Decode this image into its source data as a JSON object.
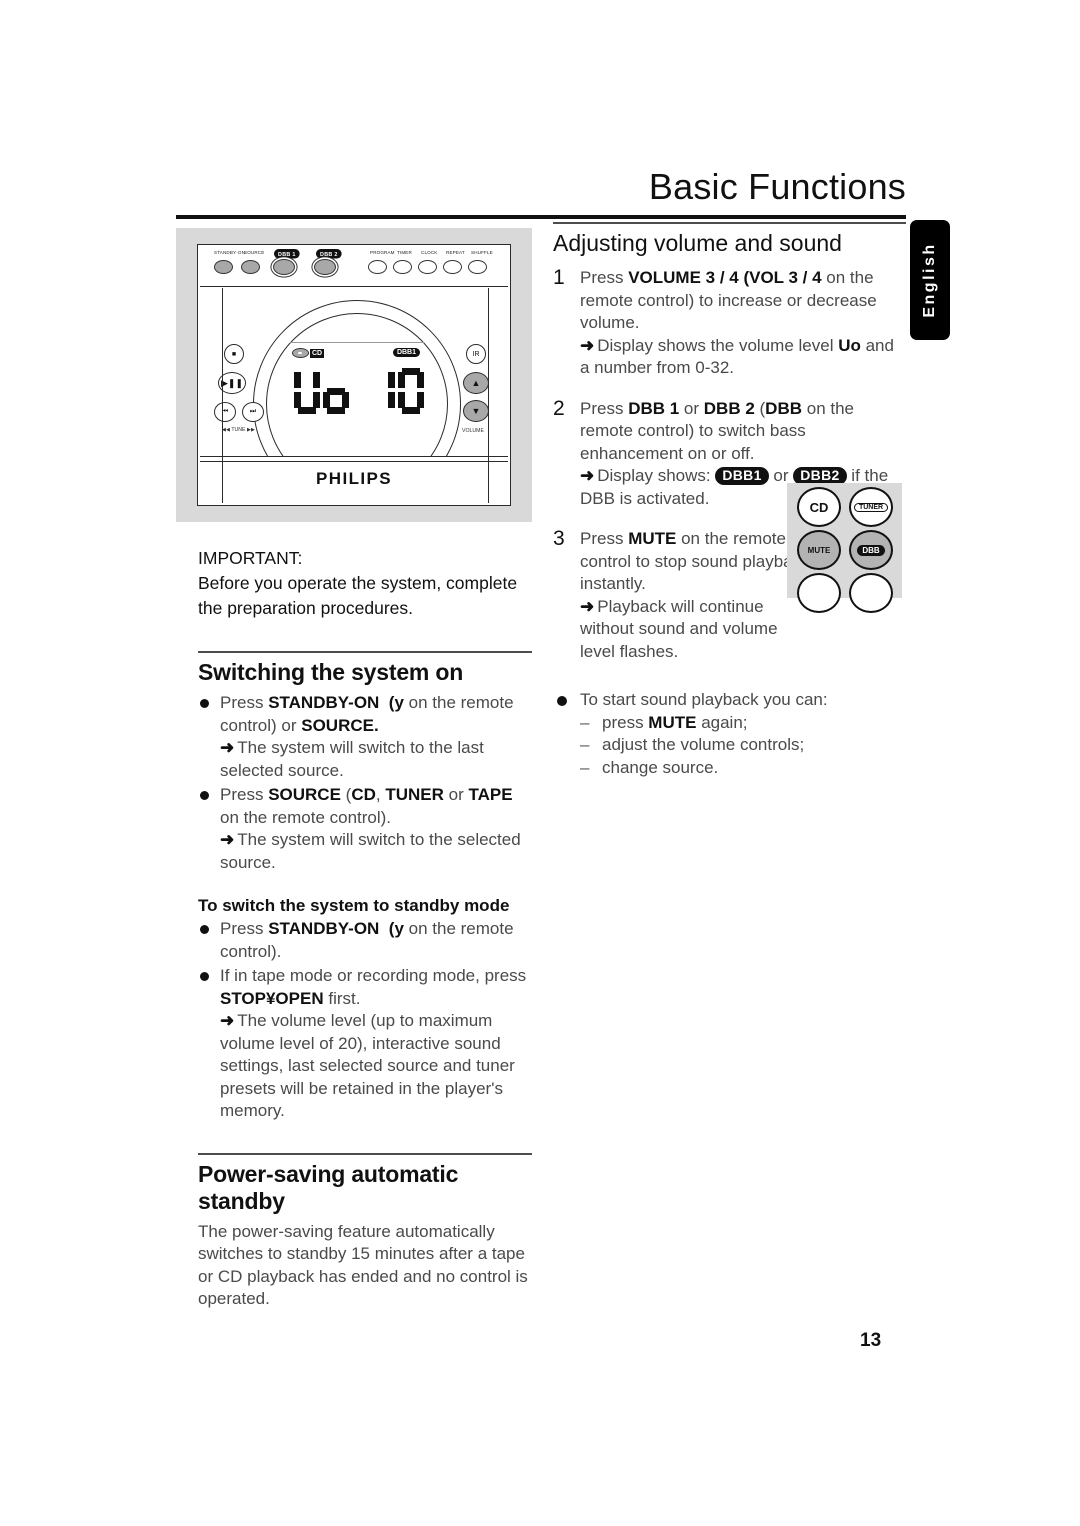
{
  "page": {
    "title": "Basic Functions",
    "number": "13",
    "language_tab": "English"
  },
  "illustration": {
    "brand": "PHILIPS",
    "top_buttons": [
      "STANDBY·ON",
      "SOURCE",
      "DBB 1",
      "DBB 2",
      "PROGRAM",
      "TIMER",
      "CLOCK",
      "REPEAT",
      "SHUFFLE"
    ],
    "display": {
      "source_indicator": "CD",
      "dbb_indicator": "DBB1",
      "readout": "Uo 10"
    },
    "side_labels": {
      "tune": "TUNE",
      "volume": "VOLUME"
    }
  },
  "left_column": {
    "important": {
      "heading": "IMPORTANT:",
      "text": "Before you operate the system, complete the preparation procedures."
    },
    "switching_on": {
      "heading": "Switching the system on",
      "bullet1_lead": "Press ",
      "bullet1_kw": "STANDBY-ON",
      "bullet1_paren_open": "(",
      "bullet1_symbol": "y",
      "bullet1_mid": " on the remote control) or ",
      "bullet1_kw2": "SOURCE.",
      "bullet1_arrow": "The system will switch to the last selected source.",
      "bullet2_lead": "Press ",
      "bullet2_kw": "SOURCE",
      "bullet2_mid1": " (",
      "bullet2_kw2": "CD",
      "bullet2_mid2": ", ",
      "bullet2_kw3": "TUNER",
      "bullet2_mid3": " or ",
      "bullet2_kw4": "TAPE",
      "bullet2_mid4": " on the remote control).",
      "bullet2_arrow": "The system will switch to the selected source."
    },
    "standby_mode": {
      "heading": "To switch the system to standby mode",
      "bullet1_lead": "Press ",
      "bullet1_kw": "STANDBY-ON",
      "bullet1_paren_open": "(",
      "bullet1_symbol": "y",
      "bullet1_mid": " on the remote control).",
      "bullet2_lead": "If in tape mode or recording mode, press ",
      "bullet2_kw": "STOP¥OPEN",
      "bullet2_tail": " first.",
      "bullet2_arrow": "The volume level (up to maximum volume level of 20), interactive sound settings, last selected source and tuner presets will be retained in the player's memory."
    },
    "power_saving": {
      "heading": "Power-saving automatic standby",
      "text": "The power-saving feature automatically switches to standby 15 minutes after a tape or CD playback has ended and no control is operated."
    }
  },
  "right_column": {
    "heading": "Adjusting volume and sound",
    "steps": [
      {
        "num": "1",
        "lead": "Press ",
        "kw": "VOLUME",
        "mid1": " 3 / 4 (",
        "kw2": "VOL",
        "mid2": " 3 / 4",
        "tail": " on the remote control) to increase or decrease volume.",
        "arrow_lead": "Display shows the volume level ",
        "arrow_kw": "Uo",
        "arrow_tail": " and a number from 0-32."
      },
      {
        "num": "2",
        "lead": "Press ",
        "kw": "DBB 1",
        "mid1": " or ",
        "kw2": "DBB 2",
        "mid2": " (",
        "kw3": "DBB",
        "tail": " on the remote control) to switch bass enhancement on or off.",
        "arrow_lead": "Display shows: ",
        "badge1": "DBB1",
        "arrow_mid": " or ",
        "badge2": "DBB2",
        "arrow_tail": " if the DBB is activated."
      },
      {
        "num": "3",
        "lead": "Press ",
        "kw": "MUTE",
        "tail": " on the remote control to stop sound playback instantly.",
        "arrow_text": "Playback will continue without sound and volume level flashes."
      }
    ],
    "bullet": {
      "text": "To start sound playback you can:",
      "items_pre": [
        "press ",
        "adjust the volume controls;",
        "change source."
      ],
      "item1_kw": "MUTE",
      "item1_tail": " again;"
    }
  },
  "remote_detail": {
    "buttons": [
      "CD",
      "TUNER",
      "MUTE",
      "DBB"
    ]
  },
  "symbols": {
    "arrow": "➜",
    "dash": "–"
  },
  "colors": {
    "ink": "#111111",
    "body_text": "#4a4a4a",
    "panel_gray": "#d9d9d9",
    "rule": "#4d4d4d"
  }
}
